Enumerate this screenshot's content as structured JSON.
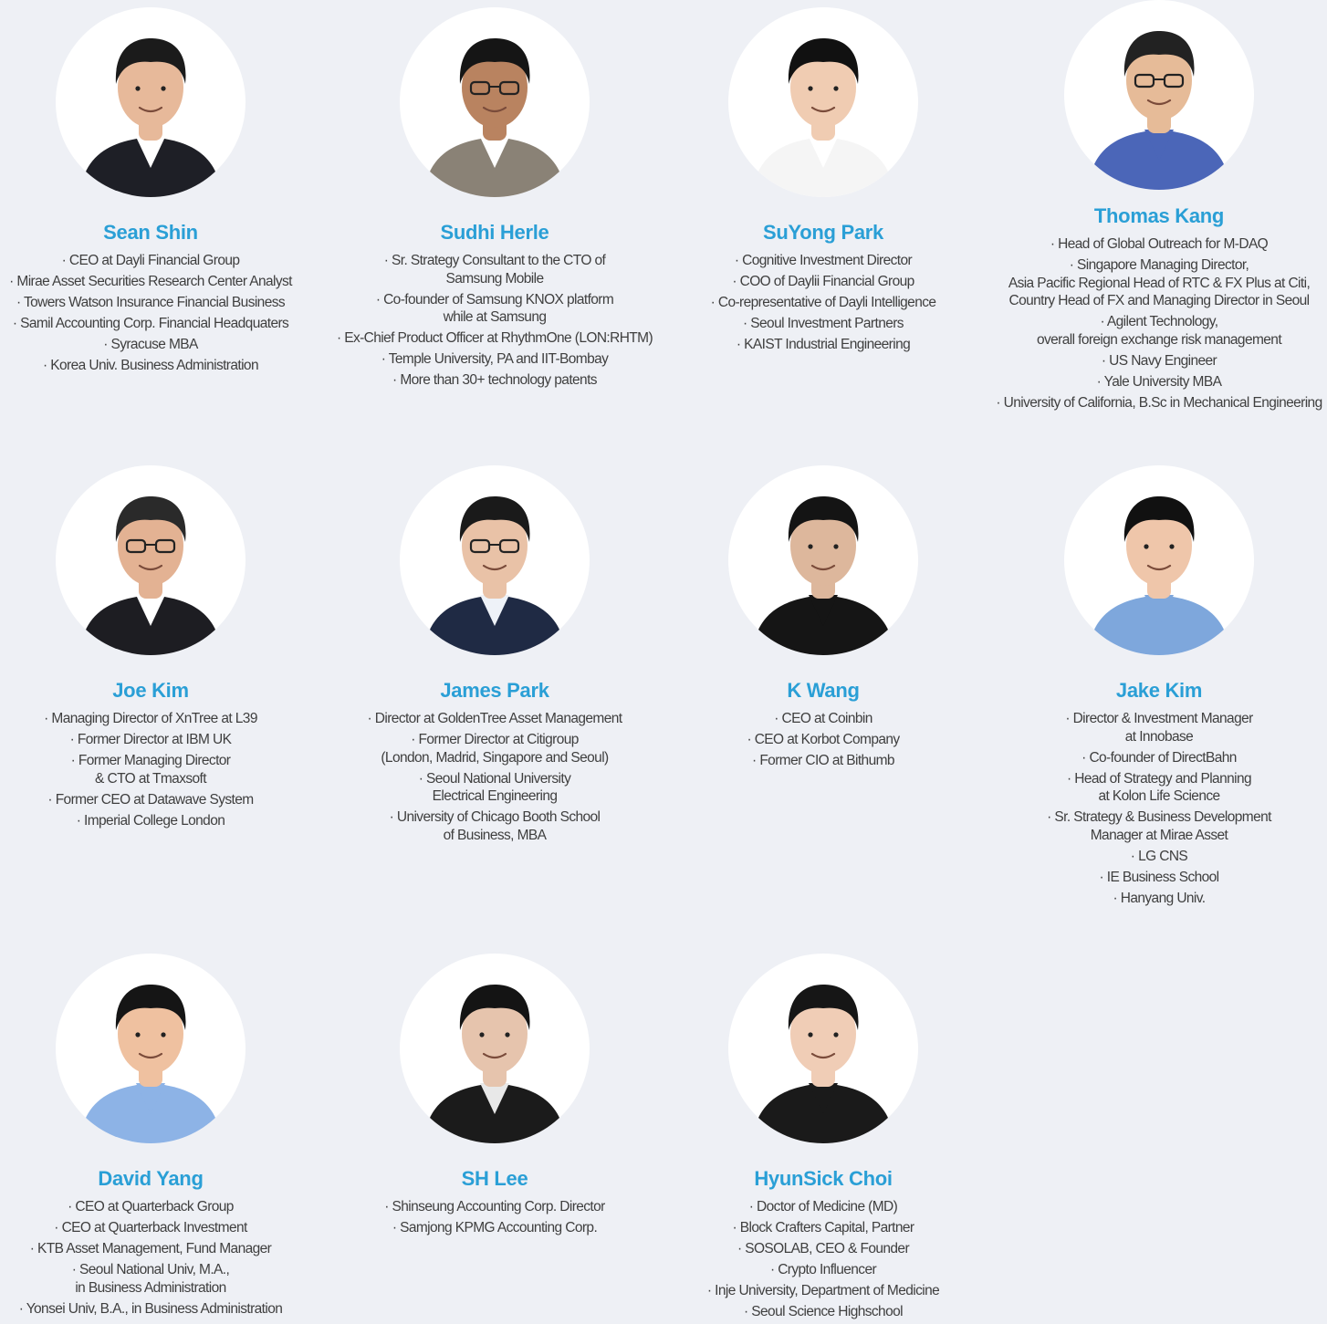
{
  "colors": {
    "background": "#eef0f5",
    "name": "#2a9fd6",
    "text": "#3f3f3f",
    "photo_bg": "#ffffff"
  },
  "people": [
    {
      "name": "Sean Shin",
      "lines": [
        "· CEO at Dayli Financial Group",
        "· Mirae Asset Securities Research Center Analyst",
        "· Towers Watson Insurance Financial Business",
        "· Samil Accounting Corp. Financial Headquaters",
        "· Syracuse MBA",
        "· Korea Univ. Business Administration"
      ]
    },
    {
      "name": "Sudhi Herle",
      "lines": [
        "· Sr. Strategy Consultant to the CTO of\nSamsung Mobile",
        "· Co-founder of Samsung KNOX platform\nwhile at Samsung",
        "· Ex-Chief Product Officer at RhythmOne (LON:RHTM)",
        "· Temple University, PA and IIT-Bombay",
        "· More than 30+ technology patents"
      ]
    },
    {
      "name": "SuYong Park",
      "lines": [
        "· Cognitive Investment Director",
        "· COO of Daylii Financial Group",
        "· Co-representative of Dayli Intelligence",
        "· Seoul Investment Partners",
        "· KAIST Industrial Engineering"
      ]
    },
    {
      "name": "Thomas Kang",
      "lines": [
        "· Head of Global Outreach for M-DAQ",
        "· Singapore Managing Director,\nAsia Pacific Regional Head of RTC & FX Plus at Citi,\nCountry Head of FX and Managing Director in Seoul",
        "· Agilent Technology,\noverall foreign exchange risk management",
        "· US Navy Engineer",
        "· Yale University MBA",
        "· University of California, B.Sc in Mechanical Engineering"
      ]
    },
    {
      "name": "Joe Kim",
      "lines": [
        "· Managing Director of XnTree at L39",
        "· Former Director at IBM UK",
        "· Former Managing Director\n& CTO at Tmaxsoft",
        "· Former CEO at Datawave System",
        "· Imperial College London"
      ]
    },
    {
      "name": "James Park",
      "lines": [
        "· Director at GoldenTree Asset Management",
        "· Former Director at Citigroup\n(London, Madrid, Singapore and Seoul)",
        "· Seoul National University\nElectrical Engineering",
        "· University of Chicago Booth School\nof Business, MBA"
      ]
    },
    {
      "name": "K Wang",
      "lines": [
        "· CEO at Coinbin",
        "· CEO at Korbot Company",
        "· Former CIO at Bithumb"
      ]
    },
    {
      "name": "Jake Kim",
      "lines": [
        "· Director & Investment Manager\nat Innobase",
        "· Co-founder of DirectBahn",
        "· Head of Strategy and Planning\nat Kolon Life Science",
        "· Sr. Strategy & Business Development\nManager at Mirae Asset",
        "· LG CNS",
        "· IE Business School",
        "· Hanyang Univ."
      ]
    },
    {
      "name": "David Yang",
      "lines": [
        "· CEO at Quarterback Group",
        "· CEO at Quarterback Investment",
        "· KTB Asset Management, Fund Manager",
        "· Seoul National Univ, M.A.,\nin Business Administration",
        "· Yonsei Univ, B.A., in Business Administration"
      ]
    },
    {
      "name": "SH Lee",
      "lines": [
        "· Shinseung Accounting Corp. Director",
        "· Samjong KPMG Accounting Corp."
      ]
    },
    {
      "name": "HyunSick Choi",
      "lines": [
        "· Doctor of Medicine (MD)",
        "· Block Crafters Capital, Partner",
        "· SOSOLAB, CEO & Founder",
        "· Crypto Influencer",
        "· Inje University, Department of Medicine",
        "· Seoul Science Highschool"
      ]
    }
  ]
}
